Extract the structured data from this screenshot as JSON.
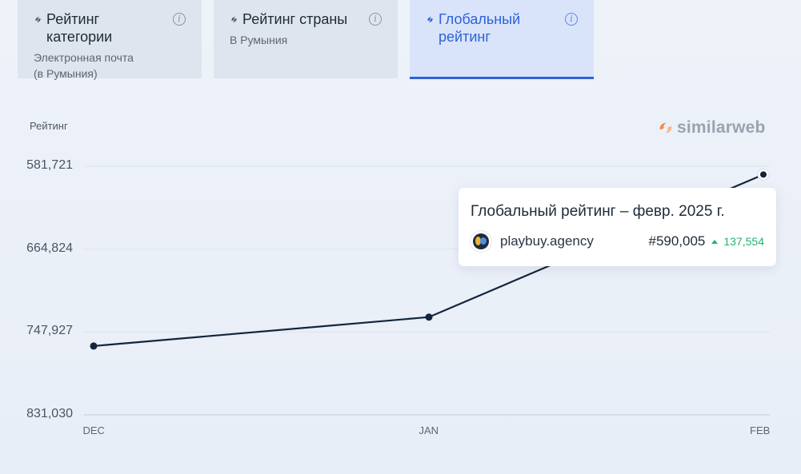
{
  "tabs": [
    {
      "title": "Рейтинг категории",
      "subtitle_line1": "Электронная почта",
      "subtitle_line2": "(в Румыния)",
      "icon": "similarweb-icon",
      "info_icon": "info-icon"
    },
    {
      "title": "Рейтинг страны",
      "subtitle_line1": "В Румыния",
      "subtitle_line2": "",
      "icon": "similarweb-icon",
      "info_icon": "info-icon"
    },
    {
      "title": "Глобальный рейтинг",
      "subtitle_line1": "",
      "subtitle_line2": "",
      "icon": "similarweb-icon",
      "info_icon": "info-icon",
      "active": true
    }
  ],
  "chart_header": {
    "rank_label": "Рейтинг",
    "logo_text": "similarweb"
  },
  "tooltip": {
    "title": "Глобальный рейтинг – февр. 2025 г.",
    "site_name": "playbuy.agency",
    "rank": "#590,005",
    "change": "137,554",
    "change_direction": "up"
  },
  "colors": {
    "active_tab_accent": "#2f62d6",
    "line": "#13253d",
    "positive_change": "#23b36c"
  },
  "chart_data": {
    "type": "line",
    "categories": [
      "DEC",
      "JAN",
      "FEB"
    ],
    "y_ticks": [
      "581,721",
      "664,824",
      "747,927",
      "831,030"
    ],
    "y_tick_values": [
      581721,
      664824,
      747927,
      831030
    ],
    "ylim": [
      581721,
      831030
    ],
    "y_inverted": true,
    "series": [
      {
        "name": "playbuy.agency",
        "values": [
          762000,
          733000,
          590005
        ]
      }
    ],
    "xlabel": "",
    "ylabel": "Рейтинг",
    "grid": true
  }
}
